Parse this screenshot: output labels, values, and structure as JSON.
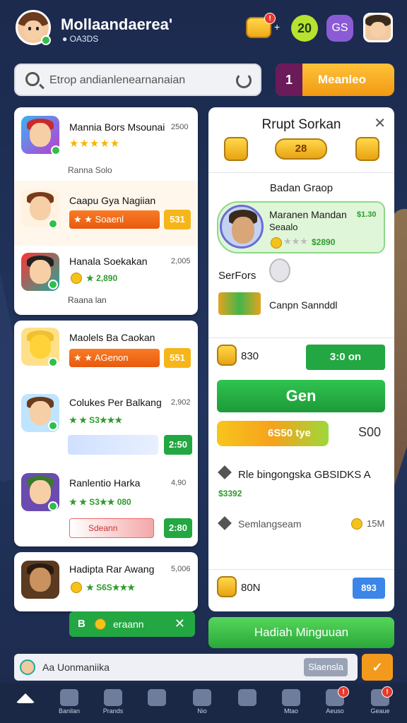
{
  "header": {
    "name": "Mollaandaerea'",
    "subtitle": "● OA3DS",
    "coin_badge": "!",
    "plus": "+",
    "level": "20",
    "gs": "GS"
  },
  "search": {
    "placeholder": "Etrop andianlenearnanaian",
    "button_num": "1",
    "button_label": "Meanleo"
  },
  "left_groups": [
    {
      "rows": [
        {
          "title": "Mannia Bors Msounai",
          "num": "2500",
          "stars": "★★★★★",
          "sub": "Ranna Solo"
        },
        {
          "title": "Caapu Gya Nagiian",
          "bar": "★ ★ Soaenl",
          "btn": "531"
        },
        {
          "title": "Hanala Soekakan",
          "num": "2,005",
          "green": "★ 2,890",
          "sub": "Raana lan"
        }
      ]
    },
    {
      "rows": [
        {
          "title": "Maolels Ba Caokan",
          "bar": "★ ★ AGenon",
          "btn": "551"
        },
        {
          "title": "Colukes Per Balkang",
          "num": "2,902",
          "green": "★ ★ S3★★★",
          "btn": "2:50"
        },
        {
          "title": "Ranlentio Harka",
          "num": "4,90",
          "green": "★ ★ S3★★ 080",
          "sub": "Sdeann",
          "btn": "2:80"
        }
      ]
    },
    {
      "rows": [
        {
          "title": "Hadipta Rar Awang",
          "num": "5,006",
          "green": "★ S6S★★★"
        }
      ]
    }
  ],
  "popup": {
    "b": "B",
    "text": "eraann",
    "close": "✕"
  },
  "right_panel": {
    "title": "Rrupt Sorkan",
    "close": "✕",
    "medal_mid": "28",
    "section": "Badan Graop",
    "profile": {
      "name": "Maranen Mandan",
      "name2": "Seaalo",
      "price": "$1.30",
      "stars": "★★★",
      "score": "$2890"
    },
    "serfors": "SerFors",
    "canpn": "Canpn Sannddl",
    "row1": {
      "v": "830",
      "btn": "3:0 on"
    },
    "gen": "Gen",
    "prog": "6S50 tye",
    "prog_val": "S00",
    "line1": {
      "t": "Rle bingongska GBSIDKS A",
      "g": "$3392"
    },
    "line2": {
      "t": "Semlangseam",
      "v": "15M"
    },
    "row2": {
      "v": "80N",
      "btn": "893"
    }
  },
  "hadiah": "Hadiah Minguuan",
  "chat": {
    "text": "Aa Uonmaniika",
    "send": "Slaensla",
    "check": "✓"
  },
  "nav": [
    {
      "label": ""
    },
    {
      "label": "Banilan"
    },
    {
      "label": "Prands"
    },
    {
      "label": ""
    },
    {
      "label": "Nio"
    },
    {
      "label": ""
    },
    {
      "label": "Mtao"
    },
    {
      "label": "Aeuso",
      "badge": "!"
    },
    {
      "label": "Geaue",
      "badge": "!"
    }
  ],
  "colors": {
    "accent_green": "#23a742",
    "accent_orange": "#f39a1c",
    "bg": "#1b2a4d"
  }
}
